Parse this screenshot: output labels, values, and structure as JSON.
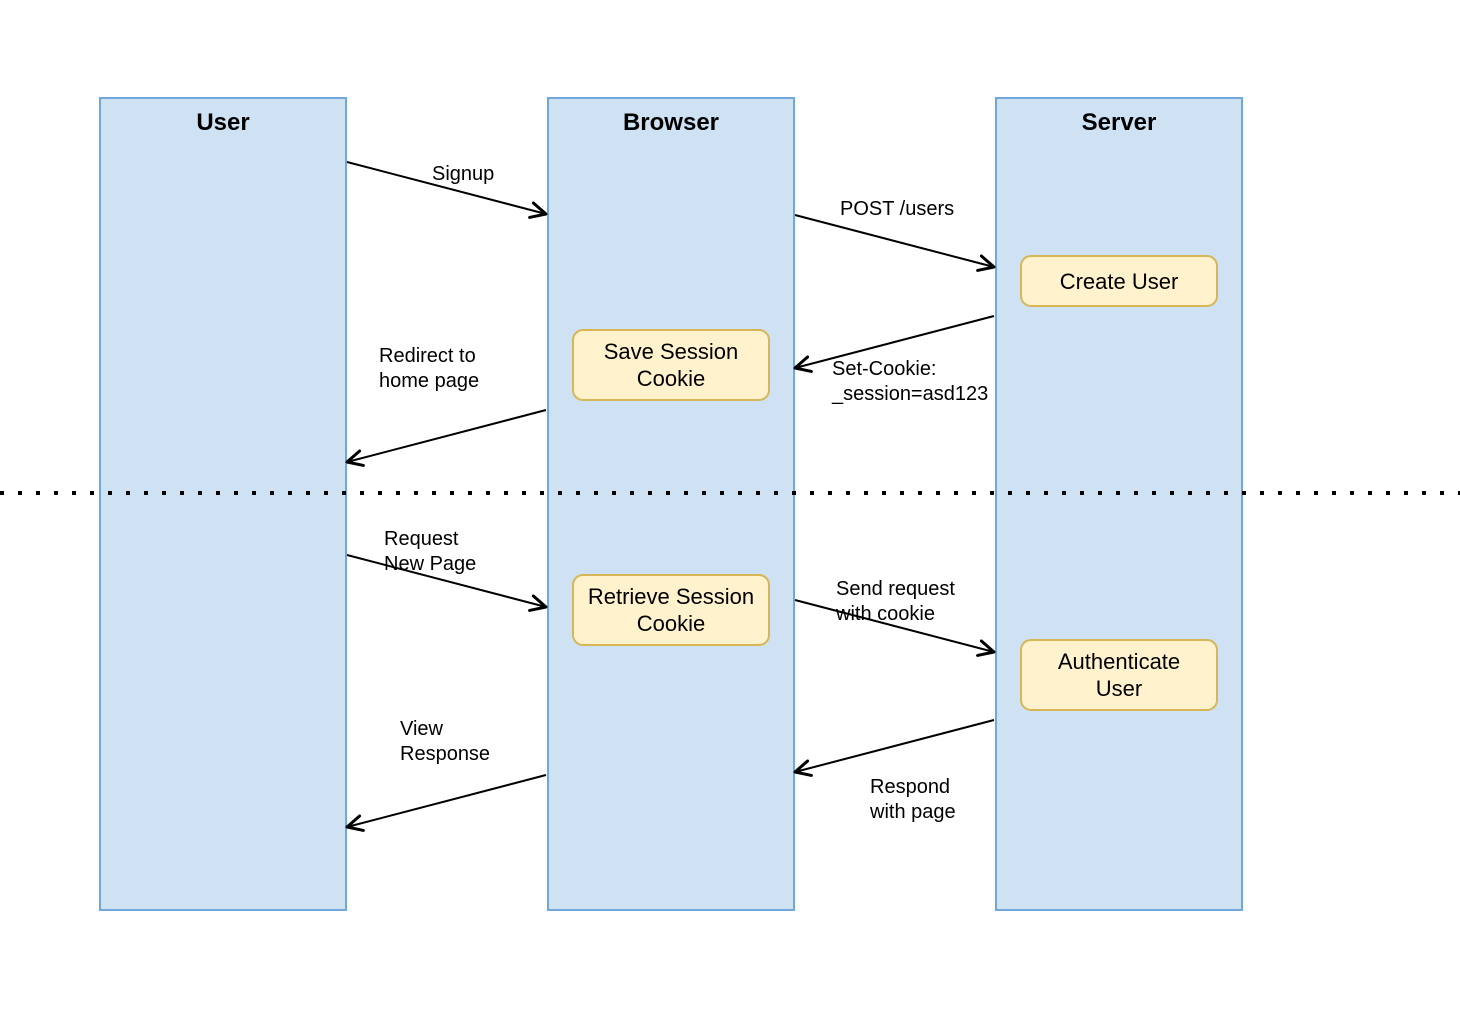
{
  "lanes": {
    "user": {
      "title": "User"
    },
    "browser": {
      "title": "Browser"
    },
    "server": {
      "title": "Server"
    }
  },
  "messages": {
    "signup": "Signup",
    "post_users": "POST /users",
    "set_cookie_l1": "Set-Cookie:",
    "set_cookie_l2": "_session=asd123",
    "redirect_l1": "Redirect to",
    "redirect_l2": "home page",
    "request_l1": "Request",
    "request_l2": "New Page",
    "send_req_l1": "Send request",
    "send_req_l2": "with cookie",
    "respond_l1": "Respond",
    "respond_l2": "with page",
    "view_l1": "View",
    "view_l2": "Response"
  },
  "activities": {
    "create_user": "Create User",
    "save_cookie_l1": "Save Session",
    "save_cookie_l2": "Cookie",
    "retrieve_cookie_l1": "Retrieve Session",
    "retrieve_cookie_l2": "Cookie",
    "auth_user_l1": "Authenticate",
    "auth_user_l2": "User"
  }
}
